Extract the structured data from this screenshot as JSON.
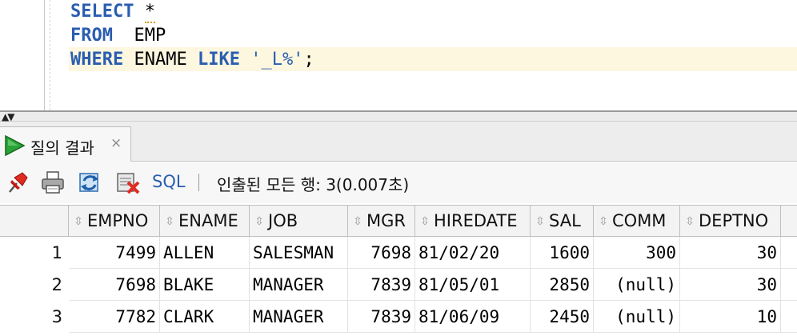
{
  "editor": {
    "line1_keyword": "SELECT",
    "line1_rest": "*",
    "line2_keyword": "FROM",
    "line2_rest": "EMP",
    "line3_keyword": "WHERE",
    "line3_mid": "ENAME",
    "line3_keyword2": "LIKE",
    "line3_string": "'_L%'",
    "line3_end": ";"
  },
  "splitter": {
    "arrows": "▲▼"
  },
  "result_tab": {
    "label": "질의 결과",
    "close": "×",
    "icon": "run-play-icon"
  },
  "toolbar": {
    "icons": [
      "pin-icon",
      "print-icon",
      "refresh-icon",
      "cancel-query-icon"
    ],
    "sql_label": "SQL",
    "separator": "|",
    "status": "인출된 모든 행: 3(0.007초)"
  },
  "grid": {
    "columns": [
      "EMPNO",
      "ENAME",
      "JOB",
      "MGR",
      "HIREDATE",
      "SAL",
      "COMM",
      "DEPTNO"
    ],
    "rows": [
      {
        "num": "1",
        "cells": [
          "7499",
          "ALLEN",
          "SALESMAN",
          "7698",
          "81/02/20",
          "1600",
          "300",
          "30"
        ]
      },
      {
        "num": "2",
        "cells": [
          "7698",
          "BLAKE",
          "MANAGER",
          "7839",
          "81/05/01",
          "2850",
          "(null)",
          "30"
        ]
      },
      {
        "num": "3",
        "cells": [
          "7782",
          "CLARK",
          "MANAGER",
          "7839",
          "81/06/09",
          "2450",
          "(null)",
          "10"
        ]
      }
    ],
    "sort_glyph": "⇳"
  },
  "colors": {
    "keyword": "#2a5db0",
    "current_line": "#fdf7e0",
    "run_green": "#2aa336"
  }
}
